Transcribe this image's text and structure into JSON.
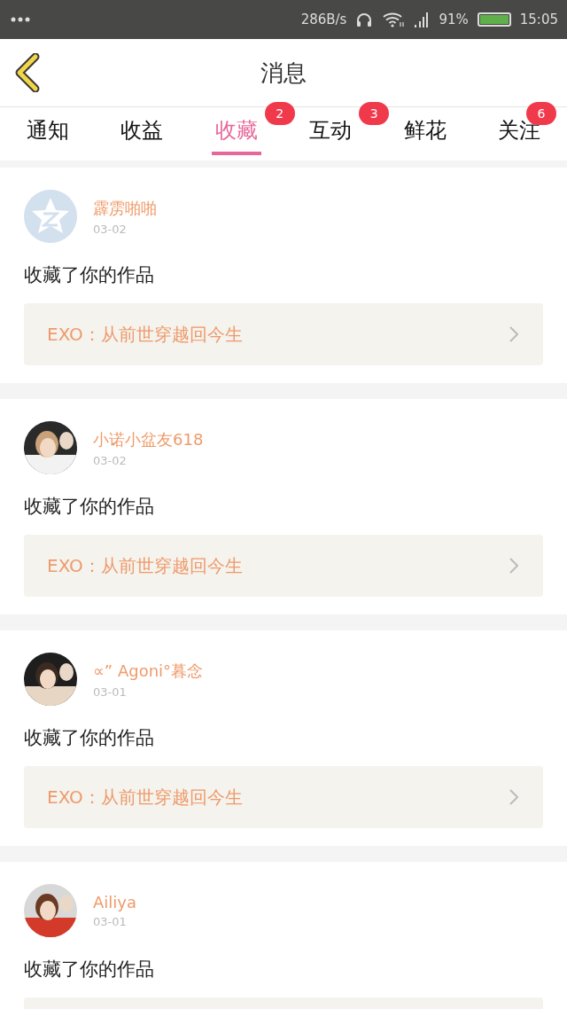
{
  "status_bar": {
    "speed": "286B/s",
    "battery_percent": "91%",
    "time": "15:05"
  },
  "header": {
    "title": "消息"
  },
  "tabs": [
    {
      "label": "通知",
      "selected": false
    },
    {
      "label": "收益",
      "selected": false
    },
    {
      "label": "收藏",
      "selected": true,
      "badge": "2"
    },
    {
      "label": "互动",
      "selected": false,
      "badge": "3"
    },
    {
      "label": "鲜花",
      "selected": false
    },
    {
      "label": "关注",
      "selected": false,
      "badge": "6"
    }
  ],
  "messages": [
    {
      "avatar": {
        "kind": "default"
      },
      "user": "霹雳啪啪",
      "date": "03-02",
      "action": "收藏了你的作品",
      "work": "EXO：从前世穿越回今生"
    },
    {
      "user": "小诺小盆友618",
      "date": "03-02",
      "action": "收藏了你的作品",
      "work": "EXO：从前世穿越回今生"
    },
    {
      "user": "∝” Agoni°暮念",
      "date": "03-01",
      "action": "收藏了你的作品",
      "work": "EXO：从前世穿越回今生"
    },
    {
      "user": "Ailiya",
      "date": "03-01",
      "action": "收藏了你的作品"
    }
  ]
}
